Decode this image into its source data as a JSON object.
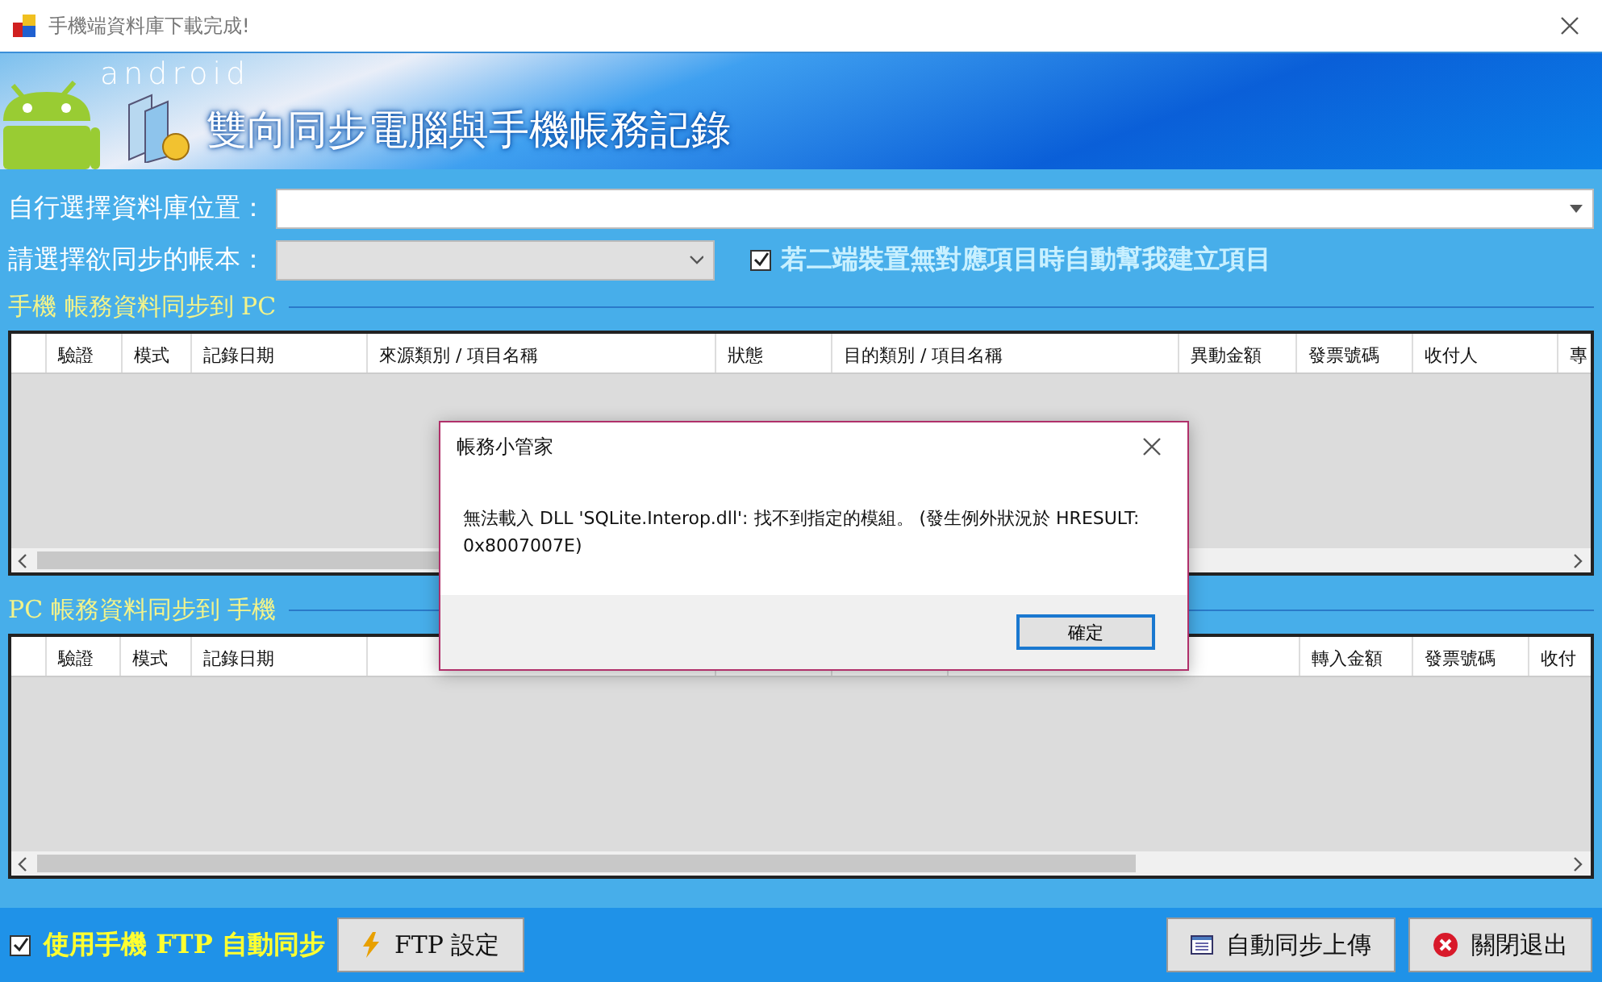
{
  "window": {
    "title": "手機端資料庫下載完成!"
  },
  "banner": {
    "logo": "android",
    "title": "雙向同步電腦與手機帳務記錄"
  },
  "db_location": {
    "label": "自行選擇資料庫位置："
  },
  "account": {
    "label": "請選擇欲同步的帳本：",
    "disabled": true
  },
  "auto_create": {
    "label": "若二端裝置無對應項目時自動幫我建立項目",
    "checked": true
  },
  "grid_phone_to_pc": {
    "title": "手機 帳務資料同步到 PC",
    "columns": [
      {
        "label": "驗證"
      },
      {
        "label": "模式"
      },
      {
        "label": "記錄日期"
      },
      {
        "label": "來源類別 / 項目名稱"
      },
      {
        "label": "狀態"
      },
      {
        "label": "目的類別 / 項目名稱"
      },
      {
        "label": "異動金額"
      },
      {
        "label": "發票號碼"
      },
      {
        "label": "收付人"
      },
      {
        "label": "專"
      }
    ]
  },
  "grid_pc_to_phone": {
    "title": "PC 帳務資料同步到 手機",
    "columns": [
      {
        "label": "驗證"
      },
      {
        "label": "模式"
      },
      {
        "label": "記錄日期"
      },
      {},
      {},
      {},
      {},
      {
        "label": "轉入金額"
      },
      {
        "label": "發票號碼"
      },
      {
        "label": "收付"
      }
    ]
  },
  "ftp_sync": {
    "label": "使用手機 FTP 自動同步",
    "checked": true
  },
  "buttons": [
    {
      "kind": "ftp",
      "label": "FTP 設定"
    },
    {
      "kind": "upload",
      "label": "自動同步上傳"
    },
    {
      "kind": "exit",
      "label": "關閉退出"
    }
  ],
  "dialog": {
    "title": "帳務小管家",
    "message": "無法載入 DLL 'SQLite.Interop.dll': 找不到指定的模組。 (發生例外狀況於 HRESULT: 0x8007007E)",
    "button": "確定"
  }
}
